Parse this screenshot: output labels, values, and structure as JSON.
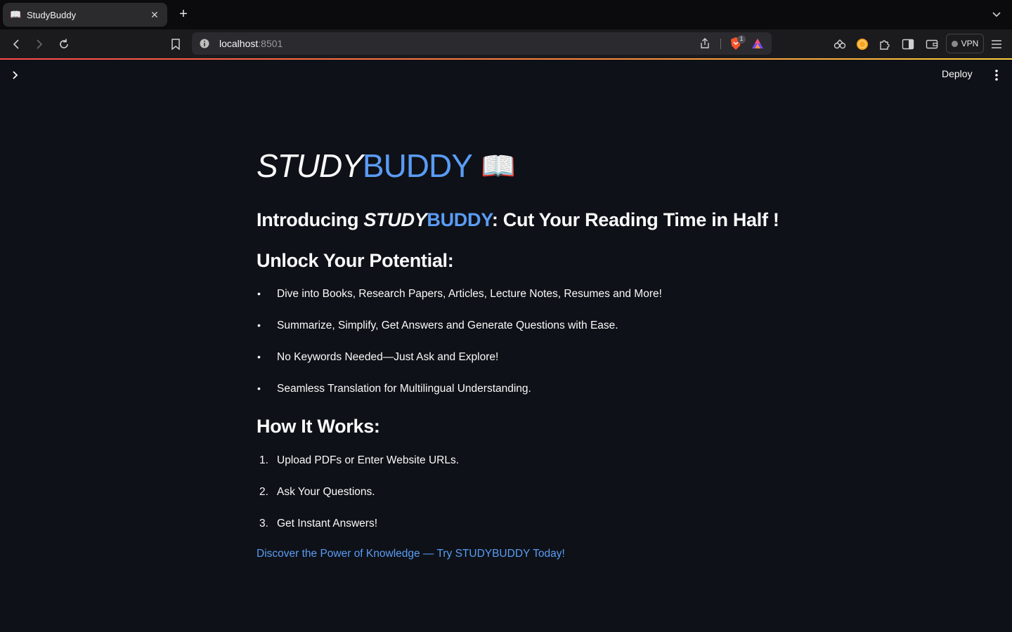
{
  "browser": {
    "tab": {
      "title": "StudyBuddy",
      "favicon": "📖"
    },
    "url": {
      "host": "localhost",
      "port": ":8501"
    },
    "brave_badge": "1",
    "vpn_label": "VPN"
  },
  "header": {
    "deploy_label": "Deploy"
  },
  "main": {
    "title_part1": "STUDY",
    "title_part2": "BUDDY",
    "title_icon": "📖",
    "intro_prefix": "Introducing ",
    "intro_brand1": "STUDY",
    "intro_brand2": "BUDDY",
    "intro_suffix": ": Cut Your Reading Time in Half !",
    "section1_heading": "Unlock Your Potential:",
    "bullets": [
      "Dive into Books, Research Papers, Articles, Lecture Notes, Resumes and More!",
      "Summarize, Simplify, Get Answers and Generate Questions with Ease.",
      "No Keywords Needed—Just Ask and Explore!",
      "Seamless Translation for Multilingual Understanding."
    ],
    "section2_heading": "How It Works:",
    "steps": [
      {
        "num": "1.",
        "text": "Upload PDFs or Enter Website URLs."
      },
      {
        "num": "2.",
        "text": "Ask Your Questions."
      },
      {
        "num": "3.",
        "text": "Get Instant Answers!"
      }
    ],
    "cta_link": "Discover the Power of Knowledge — Try STUDYBUDDY Today!"
  },
  "colors": {
    "background": "#0e1117",
    "accent_blue": "#5a9cf5",
    "text": "#fafafa"
  }
}
